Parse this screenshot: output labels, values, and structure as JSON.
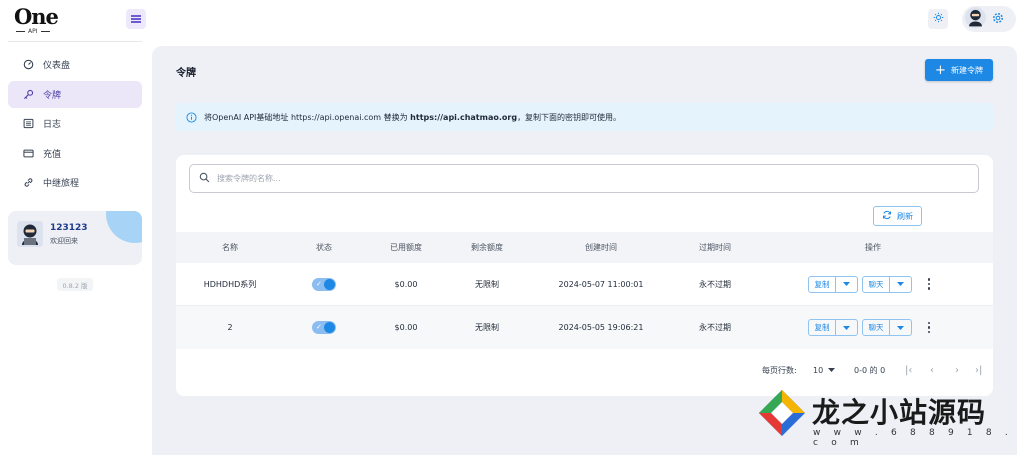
{
  "brand": {
    "logo_text": "One",
    "logo_sub": "API"
  },
  "sidebar": {
    "items": [
      {
        "label": "仪表盘",
        "icon": "dashboard-icon",
        "active": false
      },
      {
        "label": "令牌",
        "icon": "key-icon",
        "active": true
      },
      {
        "label": "日志",
        "icon": "list-icon",
        "active": false
      },
      {
        "label": "充值",
        "icon": "card-icon",
        "active": false
      },
      {
        "label": "中继旅程",
        "icon": "link-icon",
        "active": false
      }
    ],
    "user": {
      "name": "123123",
      "welcome": "欢迎回来"
    },
    "version": "0.8.2 版"
  },
  "header": {
    "theme_icon": "sun-icon",
    "settings_icon": "gear-icon"
  },
  "page": {
    "title": "令牌",
    "new_button": "新建令牌",
    "alert": {
      "prefix": "将OpenAI API基础地址 https://api.openai.com 替换为 ",
      "bold": "https://api.chatmao.org",
      "suffix": "，复制下面的密钥即可使用。"
    },
    "search_placeholder": "搜索令牌的名称...",
    "refresh_label": "刷新",
    "table": {
      "columns": [
        "名称",
        "状态",
        "已用额度",
        "剩余额度",
        "创建时间",
        "过期时间",
        "操作"
      ],
      "rows": [
        {
          "name": "HDHDHD系列",
          "enabled": true,
          "used": "$0.00",
          "remaining": "无限制",
          "created": "2024-05-07 11:00:01",
          "expires": "永不过期"
        },
        {
          "name": "2",
          "enabled": true,
          "used": "$0.00",
          "remaining": "无限制",
          "created": "2024-05-05 19:06:21",
          "expires": "永不过期"
        }
      ],
      "copy_label": "复制",
      "chat_label": "聊天"
    },
    "pagination": {
      "rows_per_page_label": "每页行数:",
      "rows_per_page": "10",
      "range": "0-0 的 0"
    }
  },
  "watermark": {
    "text": "龙之小站源码",
    "url": "w w w . 6 8 8 9 1 8 . c o m"
  }
}
